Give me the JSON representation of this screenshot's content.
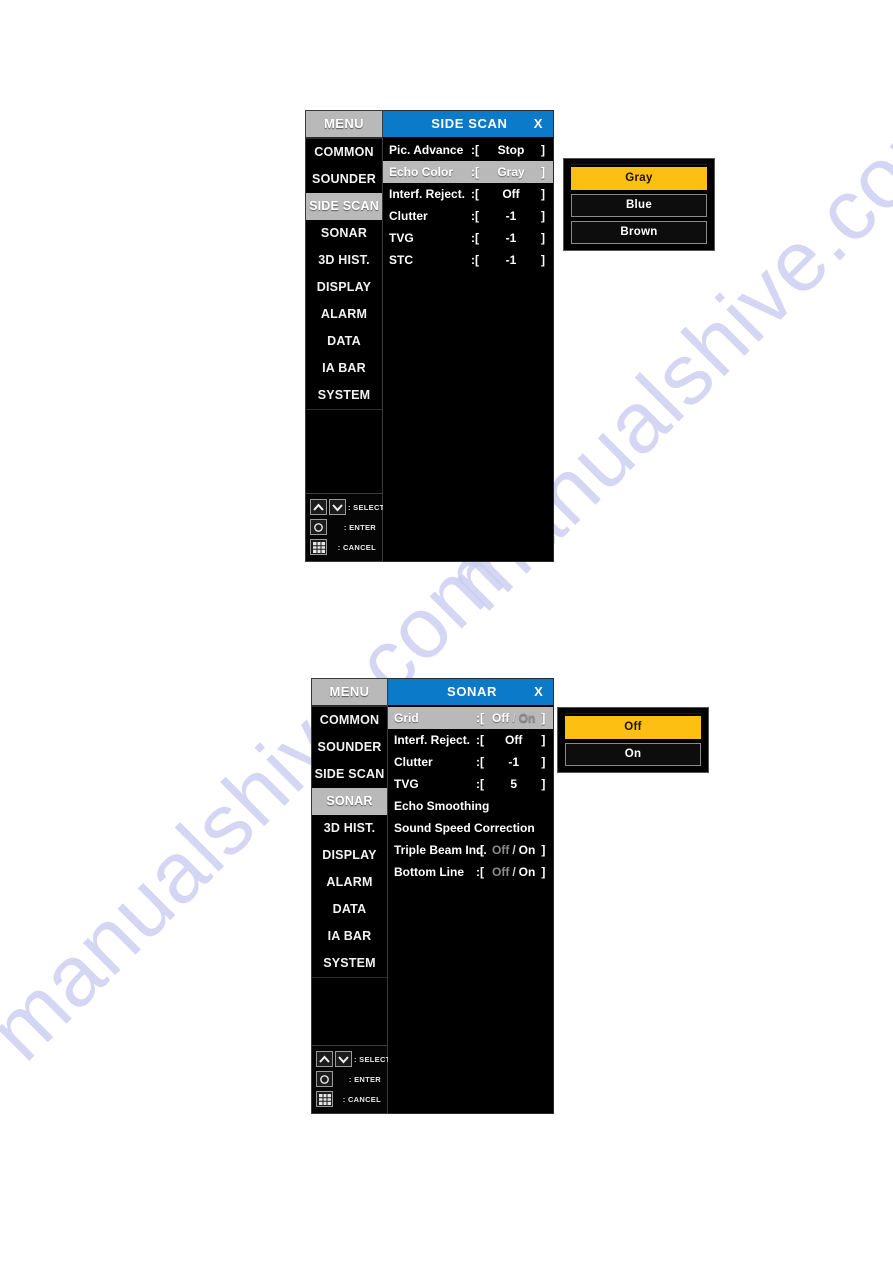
{
  "page": {
    "background_color": "#ffffff",
    "watermark_text": "manualshive.com",
    "watermark_color": "#ccccf2"
  },
  "theme": {
    "header_blue": "#0b7ac8",
    "highlight_gray": "#b9b9b9",
    "active_yellow": "#fcbf12",
    "panel_black": "#000000",
    "text_white": "#ffffff",
    "dim_gray": "#8c8c8c"
  },
  "panel_side_scan": {
    "rail": {
      "title": "MENU",
      "items": [
        {
          "label": "COMMON",
          "selected": false
        },
        {
          "label": "SOUNDER",
          "selected": false
        },
        {
          "label": "SIDE SCAN",
          "selected": true
        },
        {
          "label": "SONAR",
          "selected": false
        },
        {
          "label": "3D HIST.",
          "selected": false
        },
        {
          "label": "DISPLAY",
          "selected": false
        },
        {
          "label": "ALARM",
          "selected": false
        },
        {
          "label": "DATA",
          "selected": false
        },
        {
          "label": "IA BAR",
          "selected": false
        },
        {
          "label": "SYSTEM",
          "selected": false
        }
      ],
      "legend": [
        {
          "icon": "up-arrow-icon",
          "icon2": "down-arrow-icon",
          "label": ": SELECT"
        },
        {
          "icon": "circle-button-icon",
          "label": ": ENTER"
        },
        {
          "icon": "grid-button-icon",
          "label": ": CANCEL"
        }
      ]
    },
    "header": {
      "title": "SIDE SCAN",
      "close_label": "X"
    },
    "rows": [
      {
        "label": "Pic. Advance",
        "colon": ":[",
        "value": "Stop",
        "end": "]",
        "highlight": false,
        "dim": false
      },
      {
        "label": "Echo Color",
        "colon": ":[",
        "value": "Gray",
        "end": "]",
        "highlight": true,
        "dim": false
      },
      {
        "label": "Interf. Reject.",
        "colon": ":[",
        "value": "Off",
        "end": "]",
        "highlight": false,
        "dim": false
      },
      {
        "label": "Clutter",
        "colon": ":[",
        "value": "-1",
        "end": "]",
        "highlight": false,
        "dim": false
      },
      {
        "label": "TVG",
        "colon": ":[",
        "value": "-1",
        "end": "]",
        "highlight": false,
        "dim": false
      },
      {
        "label": "STC",
        "colon": ":[",
        "value": "-1",
        "end": "]",
        "highlight": false,
        "dim": false
      }
    ],
    "popup": {
      "name": "echo-color-options",
      "options": [
        {
          "label": "Gray",
          "active": true
        },
        {
          "label": "Blue",
          "active": false
        },
        {
          "label": "Brown",
          "active": false
        }
      ]
    }
  },
  "panel_sonar": {
    "rail": {
      "title": "MENU",
      "items": [
        {
          "label": "COMMON",
          "selected": false
        },
        {
          "label": "SOUNDER",
          "selected": false
        },
        {
          "label": "SIDE SCAN",
          "selected": false
        },
        {
          "label": "SONAR",
          "selected": true
        },
        {
          "label": "3D HIST.",
          "selected": false
        },
        {
          "label": "DISPLAY",
          "selected": false
        },
        {
          "label": "ALARM",
          "selected": false
        },
        {
          "label": "DATA",
          "selected": false
        },
        {
          "label": "IA BAR",
          "selected": false
        },
        {
          "label": "SYSTEM",
          "selected": false
        }
      ],
      "legend": [
        {
          "icon": "up-arrow-icon",
          "icon2": "down-arrow-icon",
          "label": ": SELECT"
        },
        {
          "icon": "circle-button-icon",
          "label": ": ENTER"
        },
        {
          "icon": "grid-button-icon",
          "label": ": CANCEL"
        }
      ]
    },
    "header": {
      "title": "SONAR",
      "close_label": "X"
    },
    "rows": [
      {
        "label": "Grid",
        "colon": ":[",
        "value_on": "Off",
        "sep": "/",
        "value_off": "On",
        "end": "]",
        "highlight": true,
        "toggle": true,
        "selected_side": "left"
      },
      {
        "label": "Interf. Reject.",
        "colon": ":[",
        "value": "Off",
        "end": "]",
        "highlight": false,
        "toggle": false
      },
      {
        "label": "Clutter",
        "colon": ":[",
        "value": "-1",
        "end": "]",
        "highlight": false,
        "toggle": false
      },
      {
        "label": "TVG",
        "colon": ":[",
        "value": "5",
        "end": "]",
        "highlight": false,
        "toggle": false
      },
      {
        "label": "Echo Smoothing",
        "plain": true,
        "highlight": false,
        "toggle": false
      },
      {
        "label": "Sound Speed Correction",
        "plain": true,
        "highlight": false,
        "toggle": false
      },
      {
        "label": "Triple Beam Ind.",
        "colon": ":[",
        "value_on": "Off",
        "sep": "/",
        "value_off": "On",
        "end": "]",
        "highlight": false,
        "toggle": true,
        "selected_side": "right"
      },
      {
        "label": "Bottom Line",
        "colon": ":[",
        "value_on": "Off",
        "sep": "/",
        "value_off": "On",
        "end": "]",
        "highlight": false,
        "toggle": true,
        "selected_side": "right"
      }
    ],
    "popup": {
      "name": "grid-options",
      "options": [
        {
          "label": "Off",
          "active": true
        },
        {
          "label": "On",
          "active": false
        }
      ]
    }
  }
}
